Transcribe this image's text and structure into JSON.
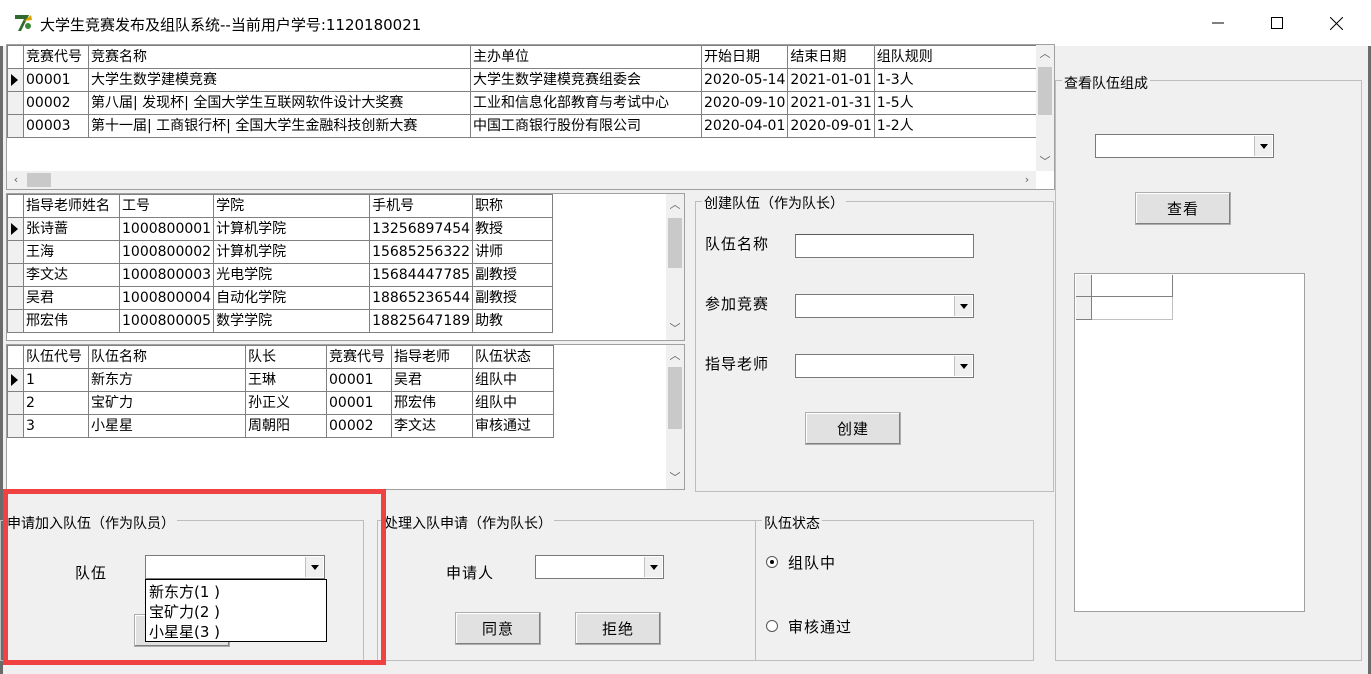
{
  "window": {
    "title": "大学生竞赛发布及组队系统--当前用户学号:1120180021",
    "minimize_label": "—",
    "maximize_label": "☐",
    "close_label": "✕"
  },
  "competitions": {
    "headers": [
      "竞赛代号",
      "竞赛名称",
      "主办单位",
      "开始日期",
      "结束日期",
      "组队规则"
    ],
    "rows": [
      [
        "00001",
        "大学生数学建模竞赛",
        "大学生数学建模竞赛组委会",
        "2020-05-14",
        "2021-01-01",
        "1-3人"
      ],
      [
        "00002",
        "第八届| 发现杯| 全国大学生互联网软件设计大奖赛",
        "工业和信息化部教育与考试中心",
        "2020-09-10",
        "2021-01-31",
        "1-5人"
      ],
      [
        "00003",
        "第十一届| 工商银行杯| 全国大学生金融科技创新大赛",
        "中国工商银行股份有限公司",
        "2020-04-01",
        "2020-09-01",
        "1-2人"
      ]
    ]
  },
  "teachers": {
    "headers": [
      "指导老师姓名",
      "工号",
      "学院",
      "手机号",
      "职称"
    ],
    "rows": [
      [
        "张诗蔷",
        "1000800001",
        "计算机学院",
        "13256897454",
        "教授"
      ],
      [
        "王海",
        "1000800002",
        "计算机学院",
        "15685256322",
        "讲师"
      ],
      [
        "李文达",
        "1000800003",
        "光电学院",
        "15684447785",
        "副教授"
      ],
      [
        "吴君",
        "1000800004",
        "自动化学院",
        "18865236544",
        "副教授"
      ],
      [
        "邢宏伟",
        "1000800005",
        "数学学院",
        "18825647189",
        "助教"
      ]
    ]
  },
  "teams": {
    "headers": [
      "队伍代号",
      "队伍名称",
      "队长",
      "竞赛代号",
      "指导老师",
      "队伍状态"
    ],
    "rows": [
      [
        "1",
        "新东方",
        "王琳",
        "00001",
        "吴君",
        "组队中"
      ],
      [
        "2",
        "宝矿力",
        "孙正义",
        "00001",
        "邢宏伟",
        "组队中"
      ],
      [
        "3",
        "小星星",
        "周朝阳",
        "00002",
        "李文达",
        "审核通过"
      ]
    ]
  },
  "create_team": {
    "title": "创建队伍（作为队长）",
    "name_label": "队伍名称",
    "competition_label": "参加竞赛",
    "teacher_label": "指导老师",
    "create_button": "创建"
  },
  "view_team": {
    "title": "查看队伍组成",
    "view_button": "查看"
  },
  "join_team": {
    "title": "申请加入队伍（作为队员）",
    "team_label": "队伍",
    "options": [
      "新东方(1    )",
      "宝矿力(2    )",
      "小星星(3    )"
    ]
  },
  "handle_request": {
    "title": "处理入队申请（作为队长）",
    "applicant_label": "申请人",
    "agree_button": "同意",
    "reject_button": "拒绝"
  },
  "team_status": {
    "title": "队伍状态",
    "option_forming": "组队中",
    "option_approved": "审核通过",
    "selected": "组队中"
  },
  "colors": {
    "highlight": "#f04242",
    "background": "#f0f0f0"
  }
}
